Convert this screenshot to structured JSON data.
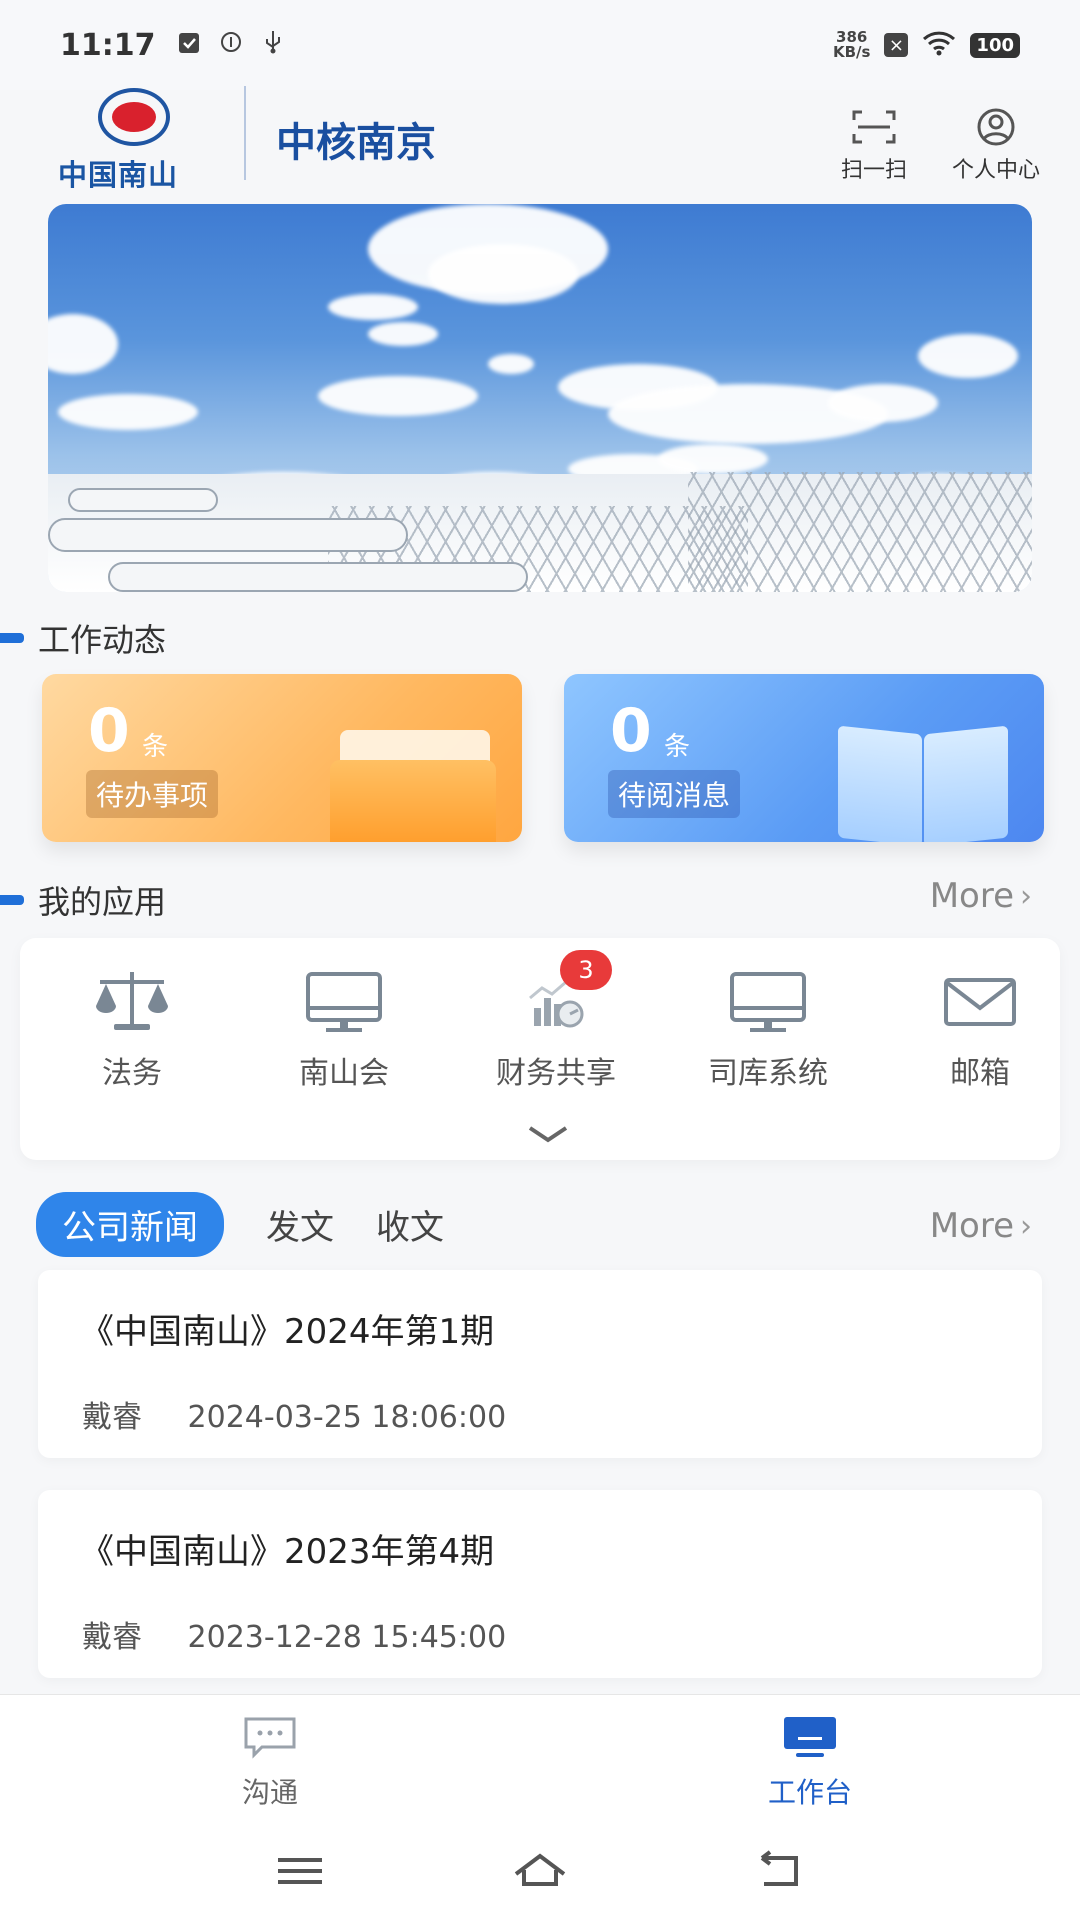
{
  "status_bar": {
    "time": "11:17",
    "net_speed_value": "386",
    "net_speed_unit": "KB/s",
    "battery": "100",
    "icons": [
      "clipboard-icon",
      "info-icon",
      "usb-icon",
      "x-icon",
      "wifi-icon",
      "battery-icon"
    ]
  },
  "header": {
    "logo_text": "中国南山",
    "brand": "中核南京",
    "scan_label": "扫一扫",
    "profile_label": "个人中心"
  },
  "work_section": {
    "title": "工作动态",
    "cards": [
      {
        "count": "0",
        "unit": "条",
        "label": "待办事项",
        "color": "#ffb860"
      },
      {
        "count": "0",
        "unit": "条",
        "label": "待阅消息",
        "color": "#5b9cf5"
      }
    ]
  },
  "apps_section": {
    "title": "我的应用",
    "more": "More",
    "apps": [
      {
        "label": "法务",
        "icon": "scales-icon"
      },
      {
        "label": "南山会",
        "icon": "monitor-icon"
      },
      {
        "label": "财务共享",
        "icon": "finance-chart-icon",
        "badge": "3"
      },
      {
        "label": "司库系统",
        "icon": "monitor-icon"
      },
      {
        "label": "邮箱",
        "icon": "mail-icon"
      }
    ]
  },
  "news_section": {
    "tabs": [
      "公司新闻",
      "发文",
      "收文"
    ],
    "active_tab": "公司新闻",
    "more": "More",
    "items": [
      {
        "title": "《中国南山》2024年第1期",
        "author": "戴睿",
        "time": "2024-03-25 18:06:00"
      },
      {
        "title": "《中国南山》2023年第4期",
        "author": "戴睿",
        "time": "2023-12-28 15:45:00"
      }
    ]
  },
  "bottom_nav": {
    "items": [
      {
        "label": "沟通",
        "icon": "chat-icon",
        "active": false
      },
      {
        "label": "工作台",
        "icon": "workbench-icon",
        "active": true
      }
    ],
    "active_color": "#2060c8"
  },
  "colors": {
    "accent": "#2f85ea",
    "brand": "#1a4fa0",
    "badge": "#e83a3a"
  }
}
